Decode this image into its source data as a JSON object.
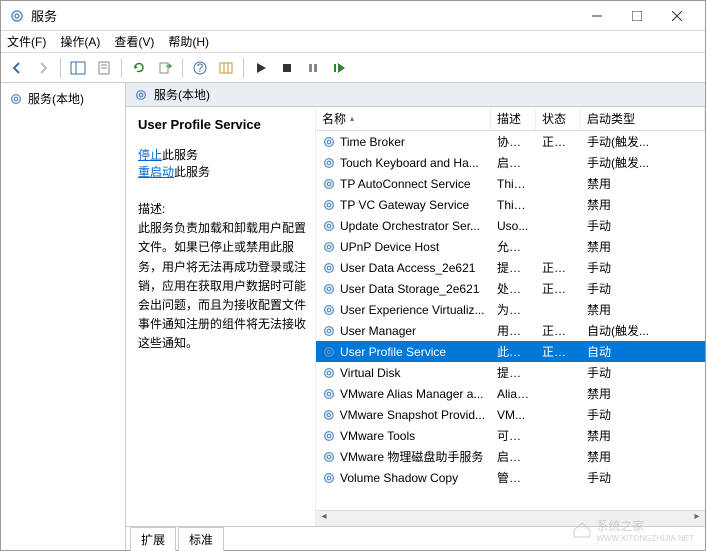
{
  "window": {
    "title": "服务"
  },
  "menu": {
    "file": "文件(F)",
    "action": "操作(A)",
    "view": "查看(V)",
    "help": "帮助(H)"
  },
  "left": {
    "node": "服务(本地)"
  },
  "righthdr": {
    "label": "服务(本地)"
  },
  "detail": {
    "heading": "User Profile Service",
    "stop": "停止",
    "stop_suffix": "此服务",
    "restart": "重启动",
    "restart_suffix": "此服务",
    "desc_label": "描述:",
    "desc_text": "此服务负责加载和卸载用户配置文件。如果已停止或禁用此服务，用户将无法再成功登录或注销，应用在获取用户数据时可能会出问题，而且为接收配置文件事件通知注册的组件将无法接收这些通知。"
  },
  "columns": {
    "name": "名称",
    "desc": "描述",
    "status": "状态",
    "start": "启动类型"
  },
  "services": [
    {
      "name": "Time Broker",
      "desc": "协调...",
      "status": "正在...",
      "start": "手动(触发...",
      "sel": false
    },
    {
      "name": "Touch Keyboard and Ha...",
      "desc": "启用...",
      "status": "",
      "start": "手动(触发...",
      "sel": false
    },
    {
      "name": "TP AutoConnect Service",
      "desc": "Thin...",
      "status": "",
      "start": "禁用",
      "sel": false
    },
    {
      "name": "TP VC Gateway Service",
      "desc": "Thin...",
      "status": "",
      "start": "禁用",
      "sel": false
    },
    {
      "name": "Update Orchestrator Ser...",
      "desc": "Uso...",
      "status": "",
      "start": "手动",
      "sel": false
    },
    {
      "name": "UPnP Device Host",
      "desc": "允许...",
      "status": "",
      "start": "禁用",
      "sel": false
    },
    {
      "name": "User Data Access_2e621",
      "desc": "提供...",
      "status": "正在...",
      "start": "手动",
      "sel": false
    },
    {
      "name": "User Data Storage_2e621",
      "desc": "处理...",
      "status": "正在...",
      "start": "手动",
      "sel": false
    },
    {
      "name": "User Experience Virtualiz...",
      "desc": "为应...",
      "status": "",
      "start": "禁用",
      "sel": false
    },
    {
      "name": "User Manager",
      "desc": "用户...",
      "status": "正在...",
      "start": "自动(触发...",
      "sel": false
    },
    {
      "name": "User Profile Service",
      "desc": "此服...",
      "status": "正在...",
      "start": "自动",
      "sel": true
    },
    {
      "name": "Virtual Disk",
      "desc": "提供...",
      "status": "",
      "start": "手动",
      "sel": false
    },
    {
      "name": "VMware Alias Manager a...",
      "desc": "Alias...",
      "status": "",
      "start": "禁用",
      "sel": false
    },
    {
      "name": "VMware Snapshot Provid...",
      "desc": "VM...",
      "status": "",
      "start": "手动",
      "sel": false
    },
    {
      "name": "VMware Tools",
      "desc": "可支...",
      "status": "",
      "start": "禁用",
      "sel": false
    },
    {
      "name": "VMware 物理磁盘助手服务",
      "desc": "启用...",
      "status": "",
      "start": "禁用",
      "sel": false
    },
    {
      "name": "Volume Shadow Copy",
      "desc": "管理...",
      "status": "",
      "start": "手动",
      "sel": false
    }
  ],
  "tabs": {
    "extended": "扩展",
    "standard": "标准"
  },
  "watermark": {
    "brand": "系统之家",
    "url": "WWW.XITONGZHIJIA.NET"
  }
}
